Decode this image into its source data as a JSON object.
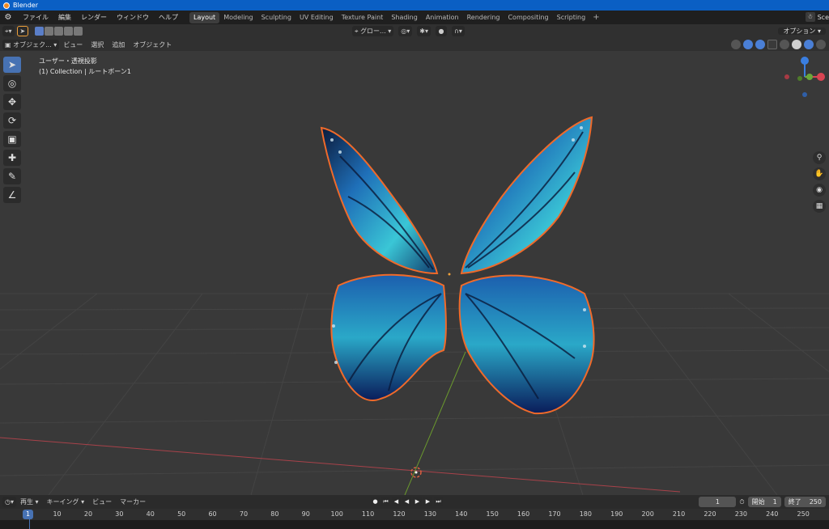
{
  "window": {
    "title": "Blender"
  },
  "topbar": {
    "menus": [
      "ファイル",
      "編集",
      "レンダー",
      "ウィンドウ",
      "ヘルプ"
    ],
    "workspaces": [
      "Layout",
      "Modeling",
      "Sculpting",
      "UV Editing",
      "Texture Paint",
      "Shading",
      "Animation",
      "Rendering",
      "Compositing",
      "Scripting"
    ],
    "active_workspace": "Layout",
    "add_label": "+",
    "scene_label": "Sce"
  },
  "header1": {
    "transform_orientation": "グロー...",
    "options_label": "オプション"
  },
  "header2": {
    "mode_label": "オブジェク...",
    "menus": [
      "ビュー",
      "選択",
      "追加",
      "オブジェクト"
    ]
  },
  "viewport": {
    "view_name": "ユーザー・透視投影",
    "collection_info": "(1) Collection | ルートボーン1",
    "accent_orange": "#f06a2a",
    "wing_blue": "#22a6d4"
  },
  "timeline": {
    "menus": [
      "再生",
      "キーイング",
      "ビュー",
      "マーカー"
    ],
    "current_frame": "1",
    "start_label": "開始",
    "start_value": "1",
    "end_label": "終了",
    "end_value": "250",
    "ruler_ticks": [
      "1",
      "10",
      "20",
      "30",
      "40",
      "50",
      "60",
      "70",
      "80",
      "90",
      "100",
      "110",
      "120",
      "130",
      "140",
      "150",
      "160",
      "170",
      "180",
      "190",
      "200",
      "210",
      "220",
      "230",
      "240",
      "250"
    ]
  }
}
